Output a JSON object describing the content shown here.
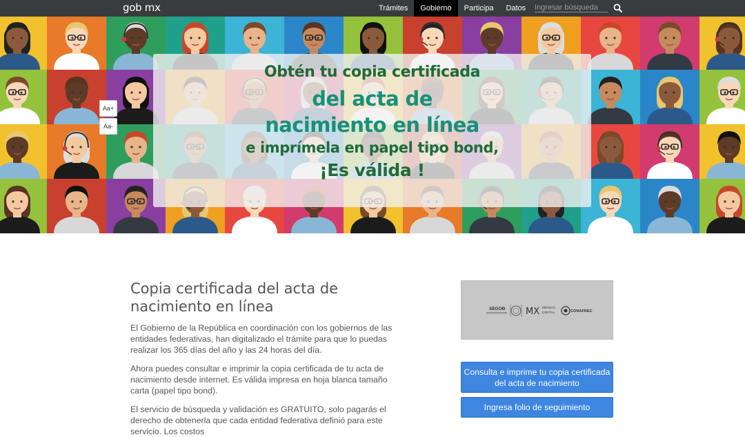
{
  "nav": {
    "logo": "gob mx",
    "links": [
      "Trámites",
      "Gobierno",
      "Participa",
      "Datos"
    ],
    "active_index": 1,
    "search_placeholder": "Ingresar búsqueda",
    "search_icon": "search-icon"
  },
  "hero": {
    "line1": "Obtén tu copia certificada",
    "line2": "del acta de",
    "line3": "nacimiento en línea",
    "line4": "e imprímela en papel tipo bond,",
    "line5": "¡Es válida !",
    "font_increase": "Aa+",
    "font_decrease": "Aa-"
  },
  "main": {
    "title": "Copia certificada del acta de nacimiento en línea",
    "p1": "El Gobierno de la República en coordinación con los gobiernos de las entidades federativas, han digitalizado el trámite para que lo puedas realizar los 365 días del año y las 24 horas del día.",
    "p2": "Ahora puedes consultar e imprimir la copia certificada de tu acta de nacimiento desde internet. Es válida impresa en hoja blanca tamaño carta (papel tipo bond).",
    "p3": "El servicio de búsqueda y validación es GRATUITO, solo pagarás el derecho de obtenerla que cada entidad federativa definió para este servicio. Los costos"
  },
  "sidebar": {
    "logo_segob": "SEGOB",
    "logo_mx": "MX",
    "logo_mx_sub1": "MÉXICO",
    "logo_mx_sub2": "DIGITAL",
    "logo_conafrec": "CONAFREC",
    "btn_consulta": "Consulta e imprime tu copia certificada del acta de nacimiento",
    "btn_folio": "Ingresa folio de seguimiento"
  },
  "colors": {
    "nav_bg": "#393c3e",
    "button_blue": "#3e86e0",
    "hero_green": "#1e6b3a",
    "hero_teal": "#17917a"
  }
}
